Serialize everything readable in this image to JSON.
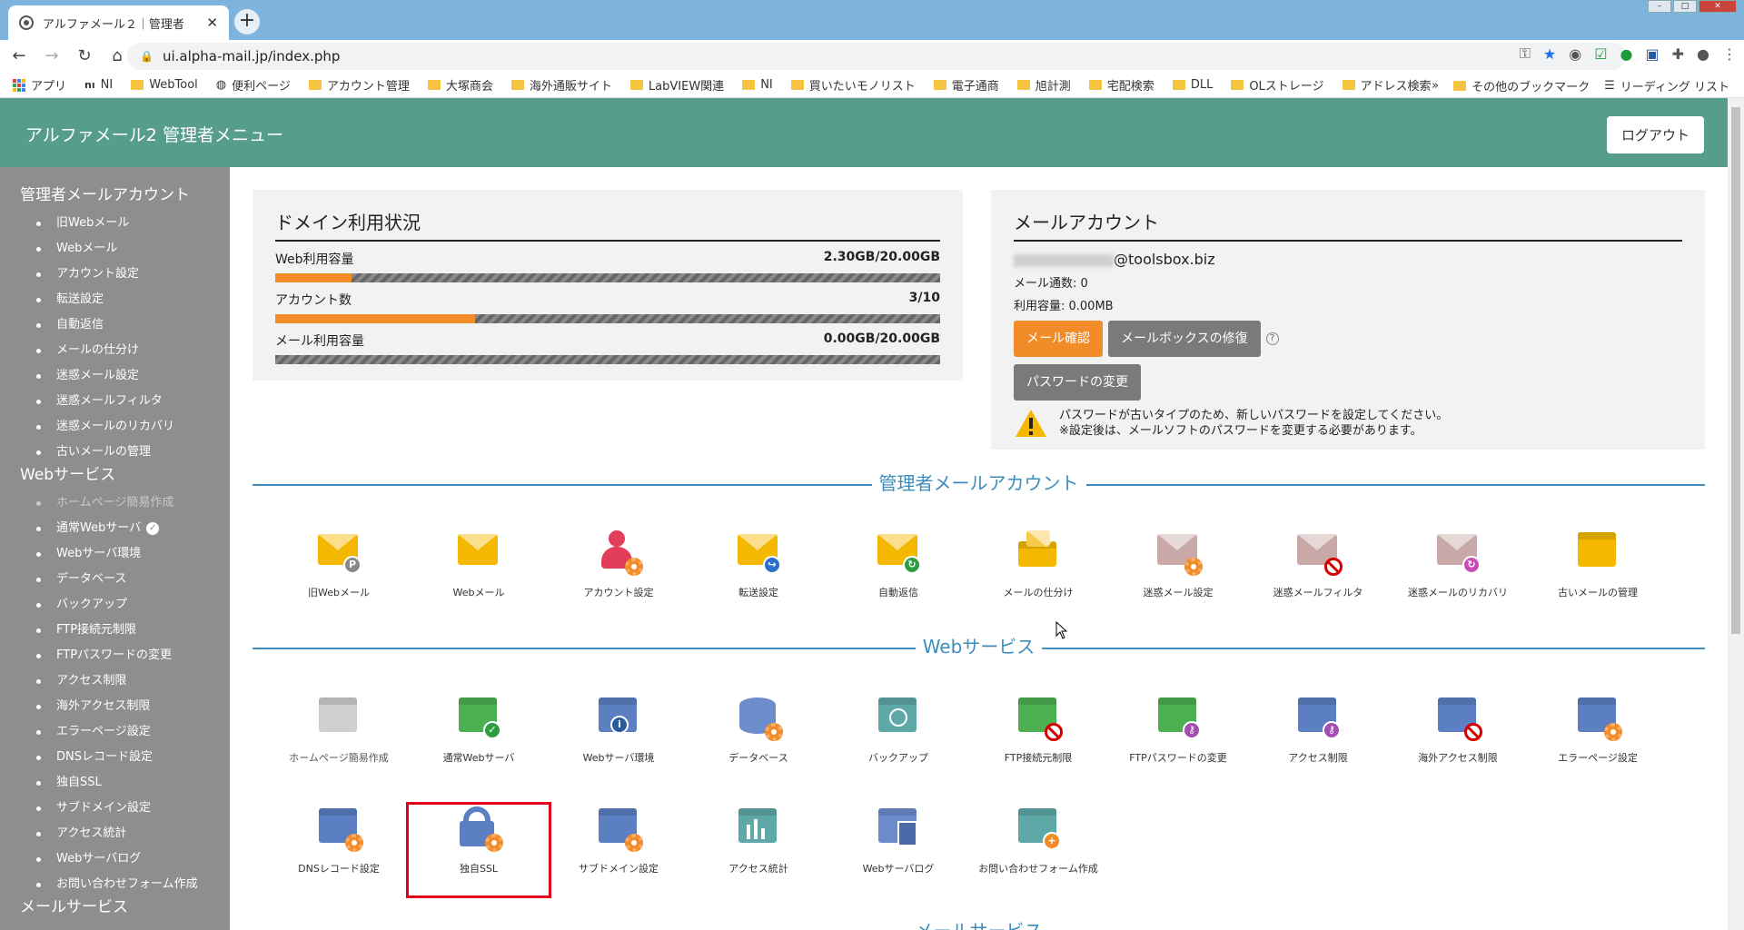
{
  "browser": {
    "tab_title": "アルファメール２｜管理者",
    "url": "ui.alpha-mail.jp/index.php",
    "bookmarks": [
      "アプリ",
      "NI",
      "WebTool",
      "便利ページ",
      "アカウント管理",
      "大塚商会",
      "海外通販サイト",
      "LabVIEW関連",
      "NI",
      "買いたいモノリスト",
      "電子通商",
      "旭計測",
      "宅配検索",
      "DLL",
      "OLストレージ",
      "アドレス検索"
    ],
    "bookmarks_more": "»",
    "other_bookmarks": "その他のブックマーク",
    "reading_list": "リーディング リスト"
  },
  "header": {
    "title": "アルファメール2 管理者メニュー",
    "logout": "ログアウト"
  },
  "sidebar": {
    "sections": [
      {
        "title": "管理者メールアカウント",
        "items": [
          "旧Webメール",
          "Webメール",
          "アカウント設定",
          "転送設定",
          "自動返信",
          "メールの仕分け",
          "迷惑メール設定",
          "迷惑メールフィルタ",
          "迷惑メールのリカバリ",
          "古いメールの管理"
        ]
      },
      {
        "title": "Webサービス",
        "items": [
          "ホームページ簡易作成",
          "通常Webサーバ",
          "Webサーバ環境",
          "データベース",
          "バックアップ",
          "FTP接続元制限",
          "FTPパスワードの変更",
          "アクセス制限",
          "海外アクセス制限",
          "エラーページ設定",
          "DNSレコード設定",
          "独自SSL",
          "サブドメイン設定",
          "アクセス統計",
          "Webサーバログ",
          "お問い合わせフォーム作成"
        ]
      },
      {
        "title": "メールサービス",
        "items": []
      }
    ]
  },
  "domain_usage": {
    "title": "ドメイン利用状況",
    "rows": [
      {
        "label": "Web利用容量",
        "value": "2.30GB/20.00GB",
        "fraction": 0.115
      },
      {
        "label": "アカウント数",
        "value": "3/10",
        "fraction": 0.3
      },
      {
        "label": "メール利用容量",
        "value": "0.00GB/20.00GB",
        "fraction": 0.0
      }
    ]
  },
  "mail_account": {
    "title": "メールアカウント",
    "email_domain": "@toolsbox.biz",
    "mail_count": "メール通数: 0",
    "usage": "利用容量: 0.00MB",
    "btn_check": "メール確認",
    "btn_repair": "メールボックスの修復",
    "help": "?",
    "btn_password": "パスワードの変更",
    "warning_line1": "パスワードが古いタイプのため、新しいパスワードを設定してください。",
    "warning_line2": "※設定後は、メールソフトのパスワードを変更する必要があります。"
  },
  "sections": {
    "mail": "管理者メールアカウント",
    "web": "Webサービス",
    "mail_service": "メールサービス"
  },
  "tiles_mail": [
    "旧Webメール",
    "Webメール",
    "アカウント設定",
    "転送設定",
    "自動返信",
    "メールの仕分け",
    "迷惑メール設定",
    "迷惑メールフィルタ",
    "迷惑メールのリカバリ",
    "古いメールの管理"
  ],
  "tiles_web_row1": [
    "ホームページ簡易作成",
    "通常Webサーバ",
    "Webサーバ環境",
    "データベース",
    "バックアップ",
    "FTP接続元制限",
    "FTPパスワードの変更",
    "アクセス制限",
    "海外アクセス制限",
    "エラーページ設定"
  ],
  "tiles_web_row2": [
    "DNSレコード設定",
    "独自SSL",
    "サブドメイン設定",
    "アクセス統計",
    "Webサーバログ",
    "お問い合わせフォーム作成"
  ],
  "colors": {
    "header": "#579d8b",
    "sidebar": "#8e8e8e",
    "accent_orange": "#f28c28",
    "section_blue": "#3c8dbc",
    "highlight_red": "#e0001b"
  }
}
